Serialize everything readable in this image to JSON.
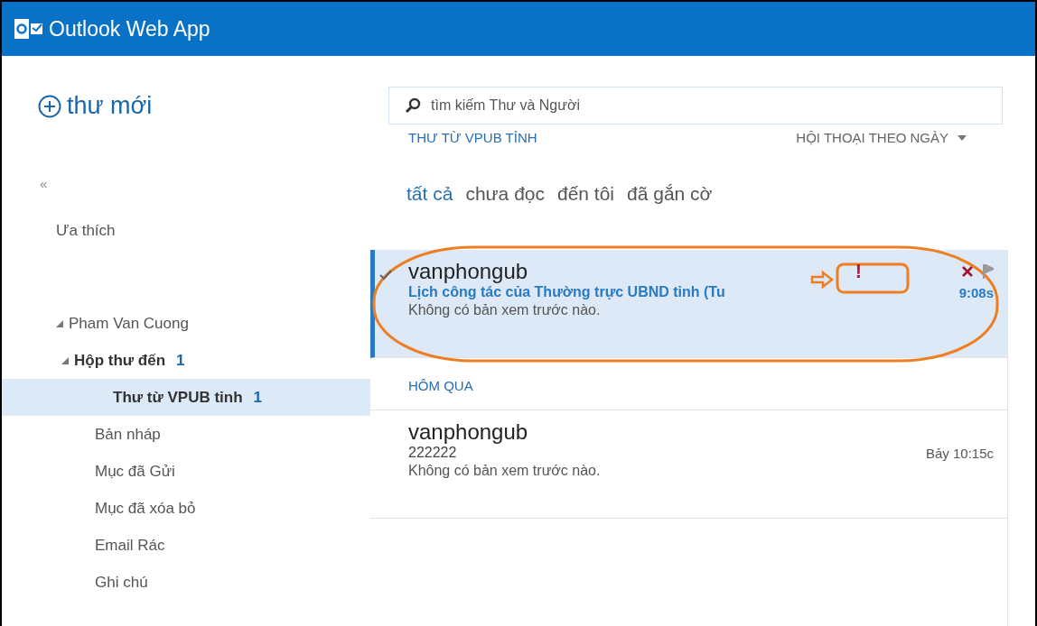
{
  "window": {
    "title": "Outlook Web App"
  },
  "new_mail": {
    "label": "thư mới"
  },
  "collapse": {
    "label": "«"
  },
  "favorites": {
    "label": "Ưa thích"
  },
  "folders": [
    {
      "label": "Pham Van Cuong",
      "expanded": true,
      "selected": false,
      "children": [
        {
          "label": "Hộp thư đến",
          "count": "1",
          "expanded": true,
          "selected": false,
          "children": [
            {
              "label": "Thư từ VPUB tỉnh",
              "count": "1",
              "selected": true
            }
          ]
        },
        {
          "label": "Bản nháp",
          "selected": false
        },
        {
          "label": "Mục đã Gửi",
          "selected": false
        },
        {
          "label": "Mục đã xóa bỏ",
          "selected": false
        },
        {
          "label": "Email Rác",
          "selected": false
        },
        {
          "label": "Ghi chú",
          "selected": false
        }
      ]
    }
  ],
  "search": {
    "placeholder": "tìm kiếm Thư và Người"
  },
  "list_title": "THƯ TỪ VPUB TỈNH",
  "sort": {
    "label": "HỘI THOẠI THEO NGÀY"
  },
  "filters": [
    {
      "label": "tất cả",
      "selected": true
    },
    {
      "label": "chưa đọc",
      "selected": false
    },
    {
      "label": "đến tôi",
      "selected": false
    },
    {
      "label": "đã gắn cờ",
      "selected": false
    }
  ],
  "messages": [
    {
      "kind": "message",
      "sender": "vanphongub",
      "subject": "Lịch công tác của Thường trực UBND tỉnh (Tu",
      "preview": "Không có bản xem trước nào.",
      "time": "9:08s",
      "selected": true,
      "unread": true,
      "checked": true,
      "importance": "!",
      "annotated": true
    },
    {
      "kind": "group",
      "label": "HÔM QUA"
    },
    {
      "kind": "message",
      "sender": "vanphongub",
      "subject": "222222",
      "preview": "Không có bản xem trước nào.",
      "time": "Bảy 10:15c",
      "selected": false,
      "unread": false
    }
  ]
}
